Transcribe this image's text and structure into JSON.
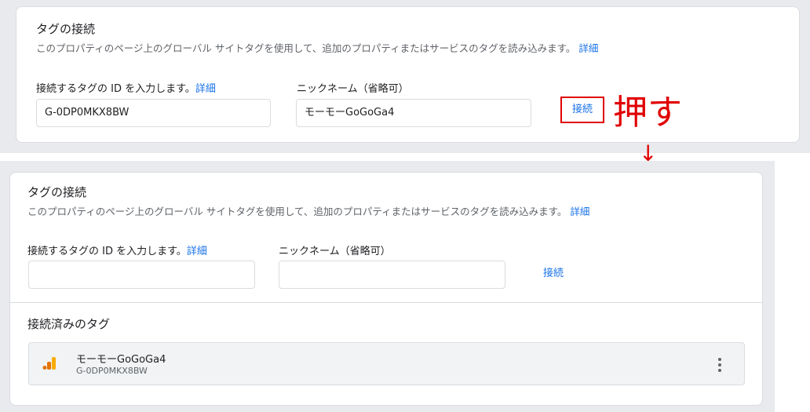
{
  "top_card": {
    "title": "タグの接続",
    "description": "このプロパティのページ上のグローバル サイトタグを使用して、追加のプロパティまたはサービスのタグを読み込みます。",
    "description_link": "詳細",
    "id_label": "接続するタグの ID を入力します。",
    "id_label_link": "詳細",
    "id_value": "G-0DP0MKX8BW",
    "nickname_label": "ニックネーム（省略可）",
    "nickname_value": "モーモーGoGoGa4",
    "connect_label": "接続"
  },
  "annotation": {
    "text": "押す",
    "arrow": "↓",
    "color": "#e00000"
  },
  "bottom_card": {
    "title": "タグの接続",
    "description": "このプロパティのページ上のグローバル サイトタグを使用して、追加のプロパティまたはサービスのタグを読み込みます。",
    "description_link": "詳細",
    "id_label": "接続するタグの ID を入力します。",
    "id_label_link": "詳細",
    "id_value": "",
    "nickname_label": "ニックネーム（省略可）",
    "nickname_value": "",
    "connect_label": "接続",
    "connected_title": "接続済みのタグ",
    "connected_tags": [
      {
        "name": "モーモーGoGoGa4",
        "id": "G-0DP0MKX8BW",
        "icon": "google-analytics-icon"
      }
    ]
  },
  "colors": {
    "link": "#1a73e8",
    "annotation": "#e00000",
    "ga_orange": "#f9ab00",
    "ga_dark_orange": "#e37400"
  }
}
